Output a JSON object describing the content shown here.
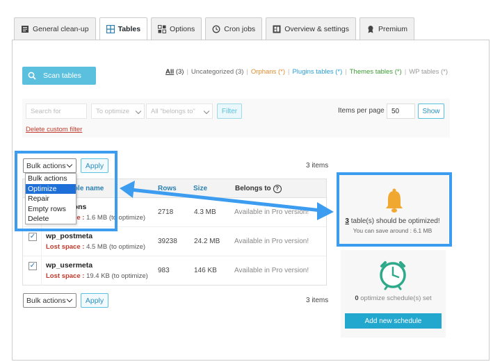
{
  "tabs": [
    {
      "label": "General clean-up",
      "icon": "document-icon"
    },
    {
      "label": "Tables",
      "icon": "table-icon"
    },
    {
      "label": "Options",
      "icon": "options-icon"
    },
    {
      "label": "Cron jobs",
      "icon": "history-icon"
    },
    {
      "label": "Overview & settings",
      "icon": "dashboard-icon"
    },
    {
      "label": "Premium",
      "icon": "award-icon"
    }
  ],
  "active_tab": "Tables",
  "scan_button": "Scan tables",
  "filter_links": {
    "all": "All",
    "all_count": "(3)",
    "uncategorized": "Uncategorized (3)",
    "orphans": "Orphans (*)",
    "plugins": "Plugins tables (*)",
    "themes": "Themes tables (*)",
    "wp": "WP tables (*)"
  },
  "search": {
    "placeholder": "Search for"
  },
  "to_optimize_select": "To optimize",
  "belongs_select": "All \"belongs to\"",
  "filter_button": "Filter",
  "items_per_page": {
    "label": "Items per page",
    "value": "50"
  },
  "show_button": "Show",
  "delete_filter": "Delete custom filter",
  "bulk_actions": {
    "selected": "Bulk actions",
    "options": [
      "Bulk actions",
      "Optimize",
      "Repair",
      "Empty rows",
      "Delete"
    ],
    "highlighted": "Optimize"
  },
  "apply_button": "Apply",
  "items_count": "3 items",
  "table": {
    "headers": {
      "name": "Table name",
      "rows": "Rows",
      "size": "Size",
      "belongs": "Belongs to",
      "help": "?"
    },
    "lost_label": "Lost space :",
    "rows": [
      {
        "name": "wp_options",
        "lost": "1.6 MB (to optimize)",
        "rows": "2718",
        "size": "4.3 MB",
        "belongs": "Available in Pro version!",
        "checked": true
      },
      {
        "name": "wp_postmeta",
        "lost": "4.5 MB (to optimize)",
        "rows": "39238",
        "size": "24.2 MB",
        "belongs": "Available in Pro version!",
        "checked": true
      },
      {
        "name": "wp_usermeta",
        "lost": "19.4 KB (to optimize)",
        "rows": "983",
        "size": "146 KB",
        "belongs": "Available in Pro version!",
        "checked": true
      }
    ]
  },
  "optimize_card": {
    "count": "3",
    "text": " table(s) should be optimized!",
    "sub": "You can save around : 6.1 MB"
  },
  "schedule_card": {
    "count": "0",
    "text": " optimize schedule(s) set",
    "button": "Add new schedule"
  },
  "colors": {
    "accent": "#5bc0de",
    "highlight": "#3b9cf0",
    "bell": "#f0a830",
    "clock": "#2eaa8a",
    "danger": "#c0392b"
  }
}
